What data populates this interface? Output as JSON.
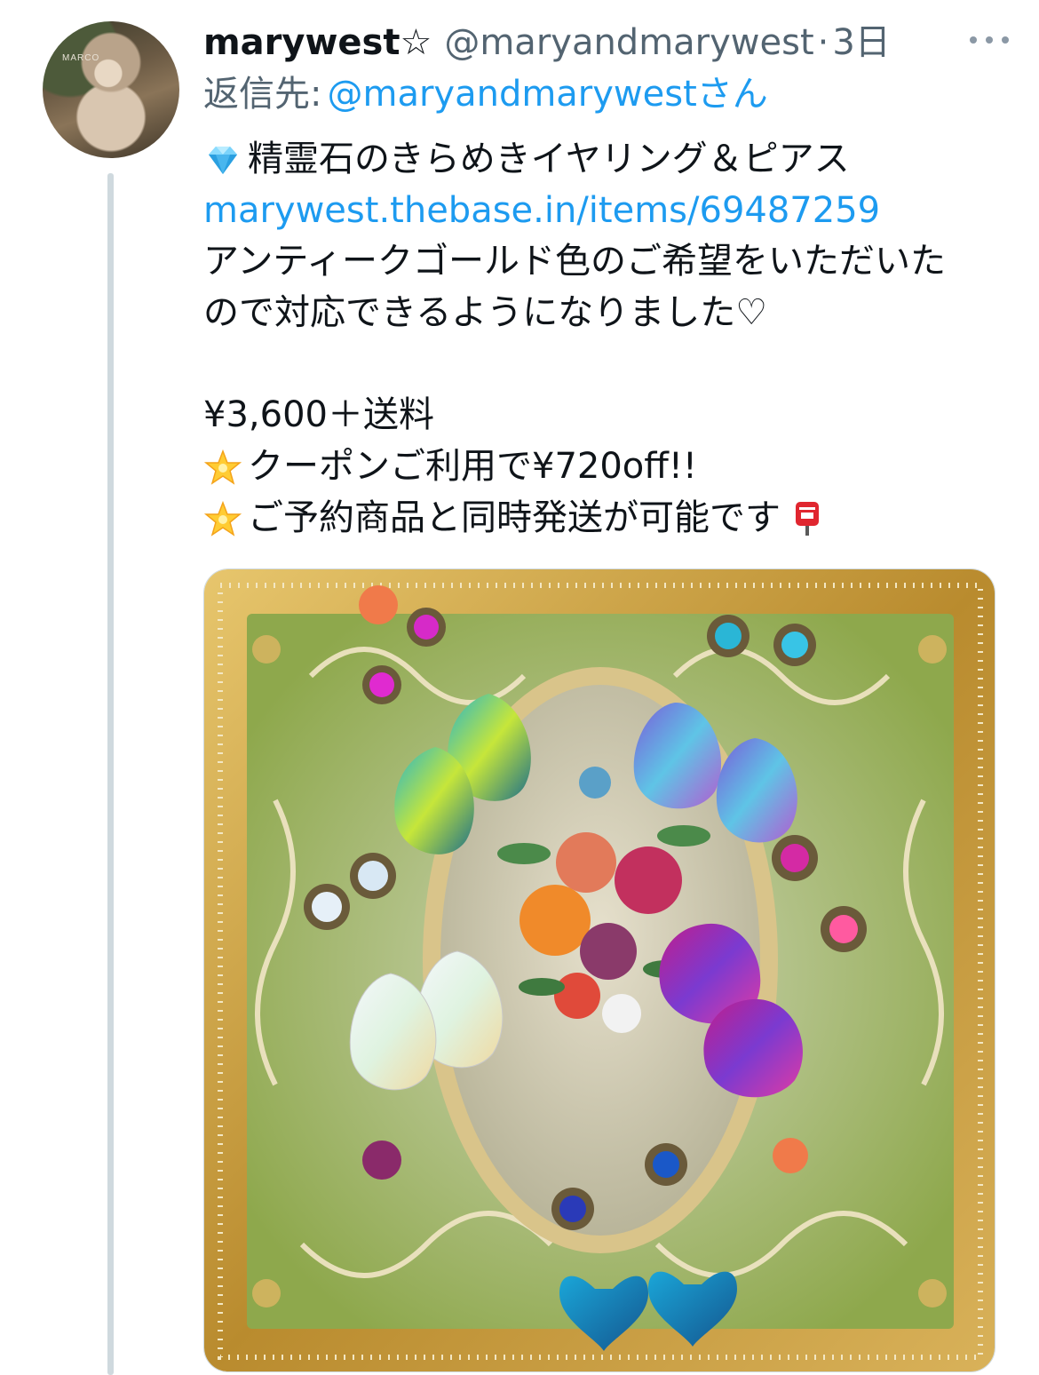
{
  "tweet": {
    "display_name": "marywest☆",
    "handle": "@maryandmarywest",
    "separator": "·",
    "time": "3日",
    "reply": {
      "label": "返信先:",
      "mention": "@maryandmarywest",
      "suffix": "さん"
    },
    "lines": {
      "title": "精霊石のきらめきイヤリング＆ピアス",
      "link": "marywest.thebase.in/items/69487259",
      "text1": "アンティークゴールド色のご希望をいただいた",
      "text2": "ので対応できるようになりました♡",
      "price": "¥3,600＋送料",
      "coupon": "クーポンご利用で¥720off!!",
      "shipping": "ご予約商品と同時発送が可能です"
    },
    "emoji_icons": {
      "title": "gem-stone-icon",
      "coupon": "glowing-star-icon",
      "shipping": "glowing-star-icon",
      "shipping_end": "postbox-icon"
    },
    "media_description_colors": {
      "frame_gold": "#c9a24a",
      "panel_green": "#7a9a3a"
    },
    "colors": {
      "link": "#1d9bf0",
      "secondary_text": "#536471",
      "primary_text": "#0f1419"
    }
  }
}
